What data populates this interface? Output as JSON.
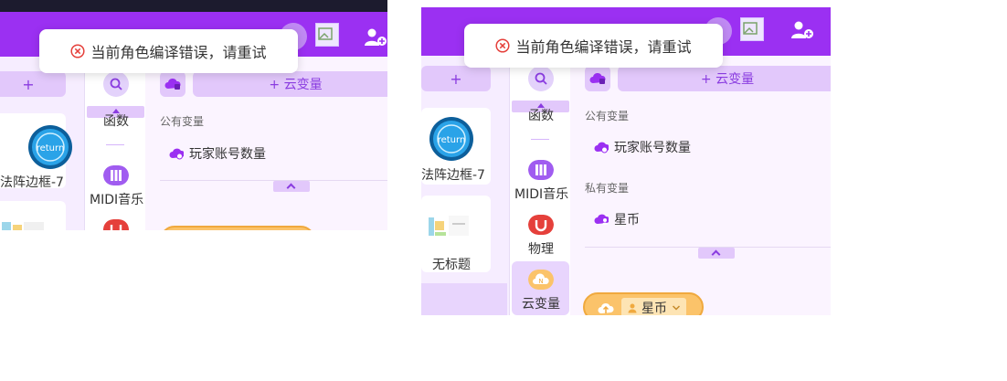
{
  "toast": {
    "message": "当前角色编译错误，请重试"
  },
  "sprites": {
    "add_label": "+",
    "items": [
      {
        "name": "法阵边框-7",
        "icon": "return-icon"
      },
      {
        "name": "无标题",
        "icon": "thumbnail"
      }
    ]
  },
  "categories": {
    "items": [
      {
        "label": "函数"
      },
      {
        "label": "MIDI音乐"
      },
      {
        "label": "物理"
      },
      {
        "label": "云变量"
      }
    ]
  },
  "variables": {
    "add_label": "+ 云变量",
    "public_title": "公有变量",
    "public_items": [
      "玩家账号数量"
    ],
    "private_title": "私有变量",
    "private_items": [
      "星币"
    ],
    "selected_cloud_var": "星币"
  },
  "colors": {
    "accent": "#9b30f2",
    "button_bg": "#e2c8fb",
    "error": "#e5403b",
    "cloud": "#fbc36a"
  }
}
